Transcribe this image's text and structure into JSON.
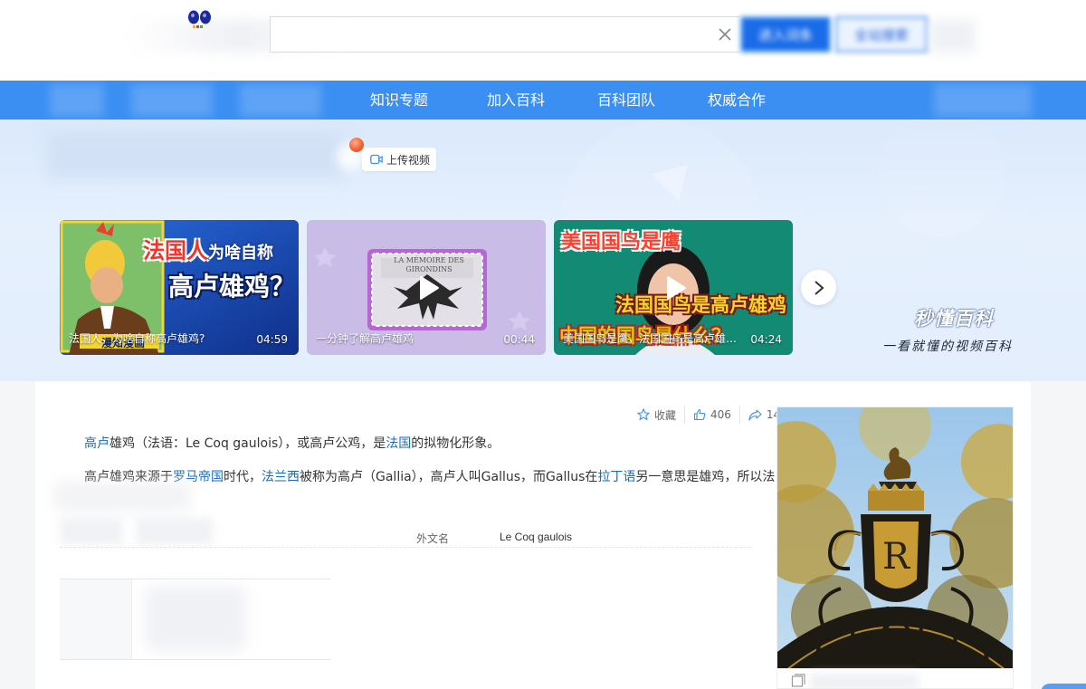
{
  "header": {
    "search_value": "",
    "search_placeholder": "",
    "enter_button": "进入词条",
    "search_button": "全站搜索"
  },
  "nav": {
    "items": [
      "知识专题",
      "加入百科",
      "百科团队",
      "权威合作"
    ]
  },
  "banner": {
    "upload_label": "上传视频",
    "videos": [
      {
        "title": "法国人，为啥自称高卢雄鸡?",
        "duration": "04:59",
        "overlay_line1": "法国人",
        "overlay_line1b": "为啥自称",
        "overlay_line2": "高卢雄鸡？",
        "tag": "漫知漫画"
      },
      {
        "title": "一分钟了解高卢雄鸡",
        "duration": "00:44",
        "plaque": "LA MÉMOIRE DES GIRONDINS"
      },
      {
        "title": "美国国鸟是鹰，法国国鸟是高卢雄鸡…",
        "duration": "04:24",
        "overlay_line1": "美国国鸟是鹰",
        "overlay_line2": "法国国鸟是高卢雄鸡",
        "overlay_line3": "中国的国鸟是什么？"
      }
    ],
    "brand_name": "秒懂百科",
    "brand_slogan": "一看就懂的视频百科"
  },
  "actions": {
    "favorite_label": "收藏",
    "like_count": "406",
    "share_count": "14"
  },
  "article": {
    "p1": {
      "link1": "高卢",
      "t1": "雄鸡（法语：Le Coq gaulois），或高卢公鸡，是",
      "link2": "法国",
      "t2": "的拟物化形象。"
    },
    "p2": {
      "t1": "高卢雄鸡来源于",
      "link1": "罗马帝国",
      "t2": "时代，",
      "link2": "法兰西",
      "t3": "被称为高卢（Gallia），高卢人叫Gallus，而Gallus在",
      "link3": "拉丁语",
      "t4": "另一意思是雄鸡，所以法"
    }
  },
  "infobox": {
    "label": "外文名",
    "value": "Le Coq gaulois"
  },
  "colors": {
    "nav": "#3b8ff3",
    "link": "#136ec2",
    "brand_blue": "#1a6be8"
  }
}
